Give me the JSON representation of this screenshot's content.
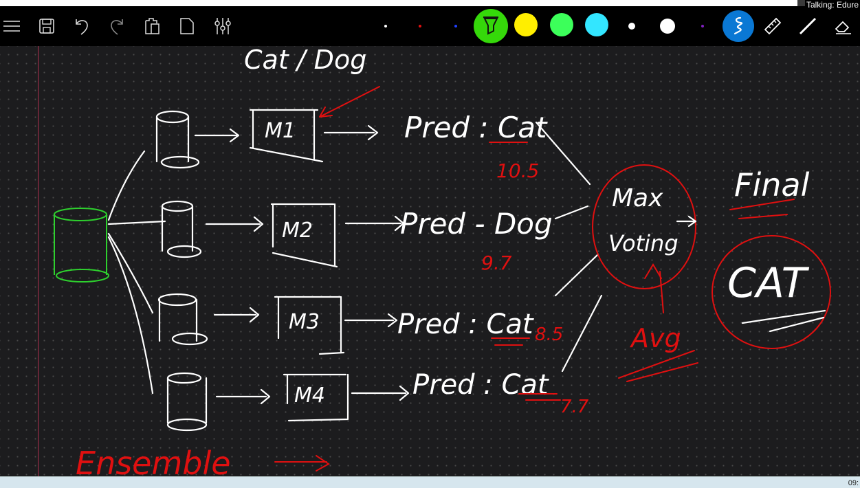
{
  "status": {
    "talking": "Talking: Edure",
    "clock": "09:"
  },
  "toolbar": {
    "tools": [
      "menu",
      "save",
      "undo",
      "redo",
      "paste",
      "new-page",
      "settings"
    ],
    "pen_colors": [
      "#ffffff",
      "#e01010",
      "#2040ff",
      "#35d80a",
      "#ffee00",
      "#3cff5a",
      "#33e6ff",
      "#ffffff",
      "#ffffff",
      "#8020c0"
    ],
    "active_color": "#35d80a",
    "accent": "#0a78d4"
  },
  "board": {
    "title": "Cat / Dog",
    "models": [
      {
        "name": "M1",
        "pred": "Pred : Cat",
        "score": "10.5"
      },
      {
        "name": "M2",
        "pred": "Pred - Dog",
        "score": "9.7"
      },
      {
        "name": "M3",
        "pred": "Pred : Cat",
        "score": "8.5"
      },
      {
        "name": "M4",
        "pred": "Pred : Cat",
        "score": "7.7"
      }
    ],
    "voter": [
      "Max",
      "Voting"
    ],
    "avg": "Avg",
    "final": "Final",
    "result": "CAT",
    "ensemble": "Ensemble"
  }
}
